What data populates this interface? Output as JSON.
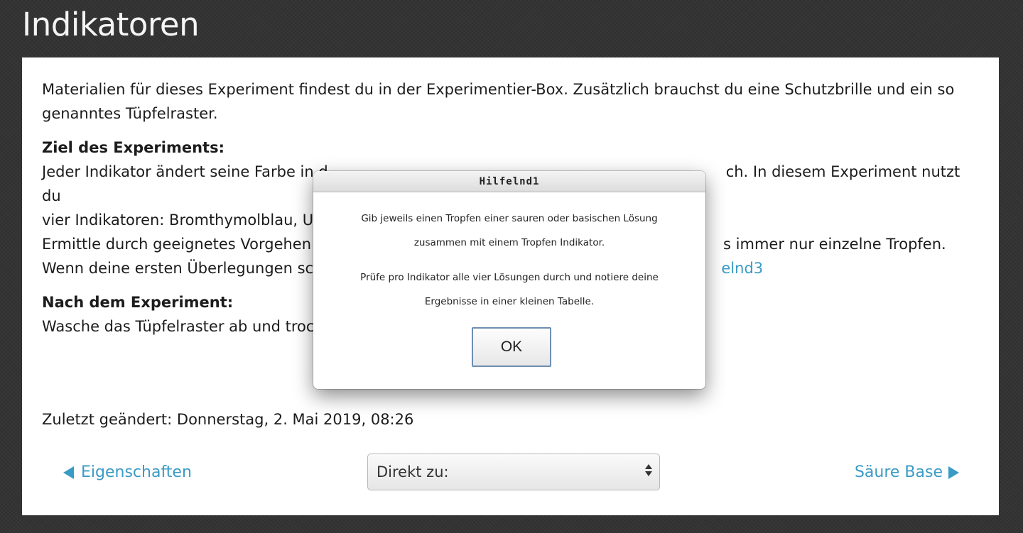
{
  "page": {
    "title": "Indikatoren"
  },
  "content": {
    "intro": "Materialien für dieses Experiment findest du in der Experimentier-Box. Zusätzlich brauchst du eine Schutzbrille und ein so genanntes Tüpfelraster.",
    "goal_heading": "Ziel des Experiments:",
    "goal_line1_start": "Jeder Indikator ändert seine Farbe in d",
    "goal_line1_end": "ch. In diesem Experiment nutzt du",
    "goal_line2": "vier Indikatoren: Bromthymolblau, Ur",
    "goal_line3_start": "Ermittle durch geeignetes Vorgehen d",
    "goal_line3_end": "s immer nur einzelne Tropfen.",
    "goal_line4_start": "Wenn deine ersten Überlegungen sch",
    "goal_line4_link": "elnd3",
    "after_heading": "Nach dem Experiment:",
    "after_text": "Wasche das Tüpfelraster ab und troc"
  },
  "footer": {
    "last_changed": "Zuletzt geändert: Donnerstag, 2. Mai 2019, 08:26",
    "prev_label": "Eigenschaften",
    "jump_label": "Direkt zu:",
    "next_label": "Säure Base"
  },
  "dialog": {
    "title": "Hilfelnd1",
    "line1": "Gib jeweils einen Tropfen einer sauren oder basischen Lösung",
    "line2": "zusammen mit einem Tropfen Indikator.",
    "line3": "Prüfe pro Indikator alle vier Lösungen durch und notiere deine",
    "line4": "Ergebnisse in einer kleinen Tabelle.",
    "ok_label": "OK"
  },
  "colors": {
    "link": "#3a9bc5",
    "background": "#333333",
    "ok_border": "#6f8db3"
  }
}
